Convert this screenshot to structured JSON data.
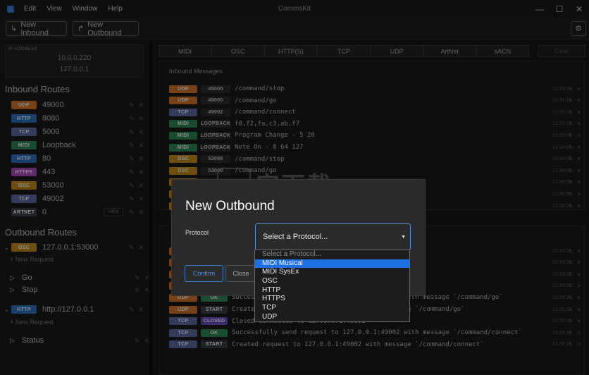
{
  "window": {
    "title": "CommsKit",
    "menu": [
      "Edit",
      "View",
      "Window",
      "Help"
    ],
    "controls": {
      "minimize": "—",
      "maximize": "☐",
      "close": "✕"
    }
  },
  "toolbar": {
    "new_inbound": "New Inbound",
    "new_outbound": "New Outbound",
    "settings_icon": "gear-icon"
  },
  "ip_address": {
    "label": "IP ADDRESS",
    "values": [
      "10.0.0.220",
      "127.0.0.1"
    ]
  },
  "inbound": {
    "title": "Inbound Routes",
    "routes": [
      {
        "proto": "UDP",
        "value": "49000",
        "color": "#d9772b"
      },
      {
        "proto": "HTTP",
        "value": "8080",
        "color": "#2f76c7"
      },
      {
        "proto": "TCP",
        "value": "5000",
        "color": "#5f6ea8"
      },
      {
        "proto": "MIDI",
        "value": "Loopback",
        "color": "#2f8a55"
      },
      {
        "proto": "HTTP",
        "value": "80",
        "color": "#2f76c7"
      },
      {
        "proto": "HTTPS",
        "value": "443",
        "color": "#b34ac4"
      },
      {
        "proto": "OSC",
        "value": "53000",
        "color": "#c98f1a"
      },
      {
        "proto": "TCP",
        "value": "49002",
        "color": "#5f6ea8"
      },
      {
        "proto": "ARTNET",
        "value": "0",
        "color": "#3a3f47"
      }
    ],
    "view_label": "VIEW"
  },
  "outbound": {
    "title": "Outbound Routes",
    "groups": [
      {
        "proto": "OSC",
        "target": "127.0.0.1:53000",
        "color": "#c98f1a",
        "new_request": "+ New Request",
        "requests": [
          "Go",
          "Stop"
        ]
      },
      {
        "proto": "HTTP",
        "target": "http://127.0.0.1",
        "color": "#2f76c7",
        "new_request": "+ New Request",
        "requests": [
          "Status"
        ]
      }
    ]
  },
  "tabs": [
    "MIDI",
    "OSC",
    "HTTP(S)",
    "TCP",
    "UDP",
    "ArtNet",
    "sACN"
  ],
  "clear_label": "Clear",
  "inbound_messages": {
    "title": "Inbound Messages",
    "rows": [
      {
        "proto": "UDP",
        "color": "#d9772b",
        "src": "49000",
        "text": "/command/stop",
        "time": "13:39:22"
      },
      {
        "proto": "UDP",
        "color": "#d9772b",
        "src": "49000",
        "text": "/command/go",
        "time": "13:39:18"
      },
      {
        "proto": "TCP",
        "color": "#5f6ea8",
        "src": "49002",
        "text": "/command/connect",
        "time": "13:39:17"
      },
      {
        "proto": "MIDI",
        "color": "#2f8a55",
        "src": "LOOPBACK",
        "text": "f0,f2,fa,c3,ab,f7",
        "time": "13:39:13"
      },
      {
        "proto": "MIDI",
        "color": "#2f8a55",
        "src": "LOOPBACK",
        "text": "Program Change - 5 20",
        "time": "13:39:08"
      },
      {
        "proto": "MIDI",
        "color": "#2f8a55",
        "src": "LOOPBACK",
        "text": "Note On - 8 64 127",
        "time": "13:39:07"
      },
      {
        "proto": "OSC",
        "color": "#c98f1a",
        "src": "53000",
        "text": "/command/stop",
        "time": "13:39:03"
      },
      {
        "proto": "OSC",
        "color": "#c98f1a",
        "src": "53000",
        "text": "/command/go",
        "time": "13:39:02"
      },
      {
        "proto": "",
        "color": "#c98f1a",
        "src": "",
        "text": "",
        "time": "13:38:59"
      },
      {
        "proto": "",
        "color": "#c98f1a",
        "src": "",
        "text": "",
        "time": "13:38:58"
      },
      {
        "proto": "",
        "color": "#c98f1a",
        "src": "",
        "text": "",
        "time": "13:38:24"
      }
    ]
  },
  "outbound_log": {
    "rows": [
      {
        "proto": "",
        "color": "#d9772b",
        "status": "",
        "status_color": "#2f8a55",
        "text": "",
        "time": "13:39:22"
      },
      {
        "proto": "",
        "color": "#d9772b",
        "status": "",
        "status_color": "#2f8a55",
        "text": "message `/command/stop`",
        "time": "13:39:22"
      },
      {
        "proto": "",
        "color": "#d9772b",
        "status": "",
        "status_color": "#2f8a55",
        "text": "/command/stop`",
        "time": "13:39:22"
      },
      {
        "proto": "",
        "color": "#d9772b",
        "status": "",
        "status_color": "#2f8a55",
        "text": "",
        "time": "13:39:22"
      },
      {
        "proto": "UDP",
        "color": "#d9772b",
        "status": "OK",
        "status_color": "#2f8a55",
        "text": "Successfully send request to 127.0.0.1:49000 with message `/command/go`",
        "time": "13:39:22"
      },
      {
        "proto": "UDP",
        "color": "#d9772b",
        "status": "START",
        "status_color": "#3a3f47",
        "text": "Created request to 127.0.0.1:49000 with message `/command/go`",
        "time": "13:39:22"
      },
      {
        "proto": "TCP",
        "color": "#5f6ea8",
        "status": "CLOSED",
        "status_color": "#6a4bc4",
        "text": "Closed connected to 127.0.0.1:49002",
        "time": "13:39:17"
      },
      {
        "proto": "TCP",
        "color": "#5f6ea8",
        "status": "OK",
        "status_color": "#2f8a55",
        "text": "Successfully send request to 127.0.0.1:49002 with message `/command/connect`",
        "time": "13:39:17"
      },
      {
        "proto": "TCP",
        "color": "#5f6ea8",
        "status": "START",
        "status_color": "#3a3f47",
        "text": "Created request to 127.0.0.1:49002 with message `/command/connect`",
        "time": "13:39:17"
      }
    ]
  },
  "modal": {
    "title": "New Outbound",
    "protocol_label": "Protocol",
    "select_value": "Select a Protocol...",
    "confirm": "Confirm",
    "close": "Close",
    "options": [
      "Select a Protocol...",
      "MIDI Musical",
      "MIDI SysEx",
      "OSC",
      "HTTP",
      "HTTPS",
      "TCP",
      "UDP"
    ],
    "highlighted_option": "MIDI Musical"
  },
  "watermark": {
    "text": "安下载",
    "sub": "anxz.com"
  }
}
